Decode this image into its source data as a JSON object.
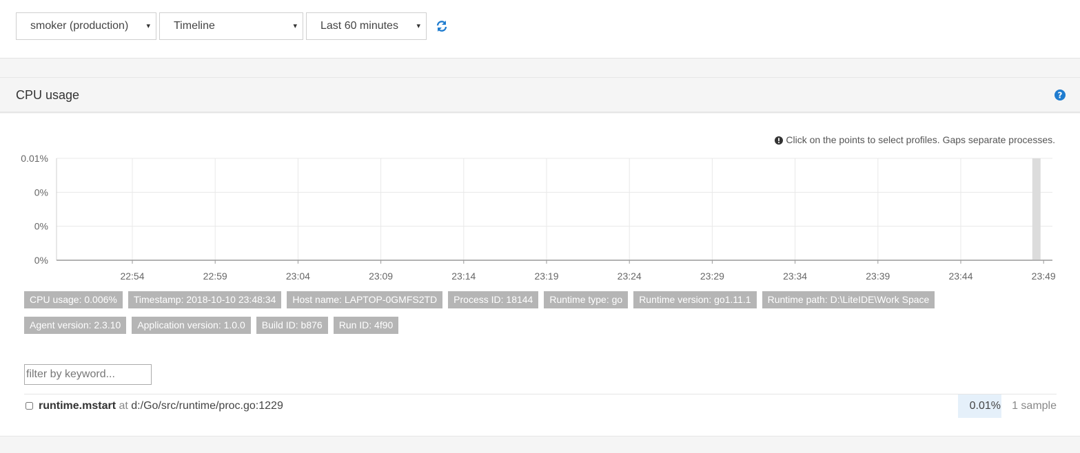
{
  "toolbar": {
    "app_select": "smoker (production)",
    "view_select": "Timeline",
    "range_select": "Last 60 minutes",
    "caret": "▾"
  },
  "panel": {
    "title": "CPU usage",
    "hint": "Click on the points to select profiles. Gaps separate processes."
  },
  "colors": {
    "accent": "#1f7ccf",
    "badge": "#b5b5b5",
    "highlight": "#e5f0fa",
    "bar": "#dcdcdc"
  },
  "chart_data": {
    "type": "bar",
    "title": "",
    "xlabel": "",
    "ylabel": "",
    "y_tick_labels": [
      "0.01%",
      "0%",
      "0%",
      "0%"
    ],
    "x_tick_labels": [
      "22:54",
      "22:59",
      "23:04",
      "23:09",
      "23:14",
      "23:19",
      "23:24",
      "23:29",
      "23:34",
      "23:39",
      "23:44",
      "23:49"
    ],
    "x_minutes_range": [
      "22:49",
      "23:49"
    ],
    "ylim": [
      0,
      0.01
    ],
    "grid": true,
    "points": [
      {
        "x": "23:48:34",
        "y": 0.006
      }
    ]
  },
  "badges": [
    [
      "CPU usage: 0.006%",
      "Timestamp: 2018-10-10 23:48:34",
      "Host name: LAPTOP-0GMFS2TD",
      "Process ID: 18144",
      "Runtime type: go",
      "Runtime version: go1.11.1",
      "Runtime path: D:\\LiteIDE\\Work Space"
    ],
    [
      "Agent version: 2.3.10",
      "Application version: 1.0.0",
      "Build ID: b876",
      "Run ID: 4f90"
    ]
  ],
  "filter": {
    "placeholder": "filter by keyword..."
  },
  "profile_rows": [
    {
      "function": "runtime.mstart",
      "at": "at",
      "location": "d:/Go/src/runtime/proc.go:1229",
      "percent": "0.01%",
      "samples": "1 sample"
    }
  ]
}
